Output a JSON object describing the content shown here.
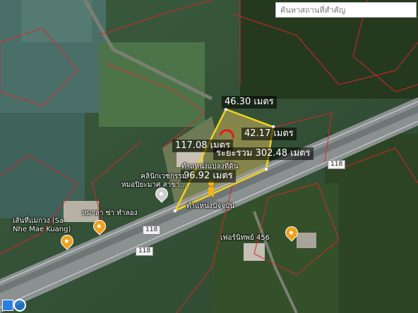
{
  "search": {
    "placeholder": "ค้นหาสถานที่สำคัญ"
  },
  "measurements": {
    "top": "46.30 เมตร",
    "right": "42.17 เมตร",
    "left": "117.08 เมตร",
    "total": "ระยะรวม 302.48 เมตร",
    "bottom": "96.92 เมตร"
  },
  "labels": {
    "plot_position": "ตำแหน่งแปลงที่ดิน",
    "current_position": "ตำแหน่งปัจจุบัน",
    "clinic": "คลินิกเวชกรรม\nหมอปิยะมาศ สาขา...",
    "farm": "หมาล่า ซ่า ทำลอง",
    "noodle": "เส้นที่แม่กวง (Sa\nNhe Mae Kuang)",
    "furniture": "เฟอร์นิทพย์ 456",
    "road_number": "118"
  },
  "colors": {
    "accent": "#f2d21a",
    "boundary": "#d8262b"
  }
}
